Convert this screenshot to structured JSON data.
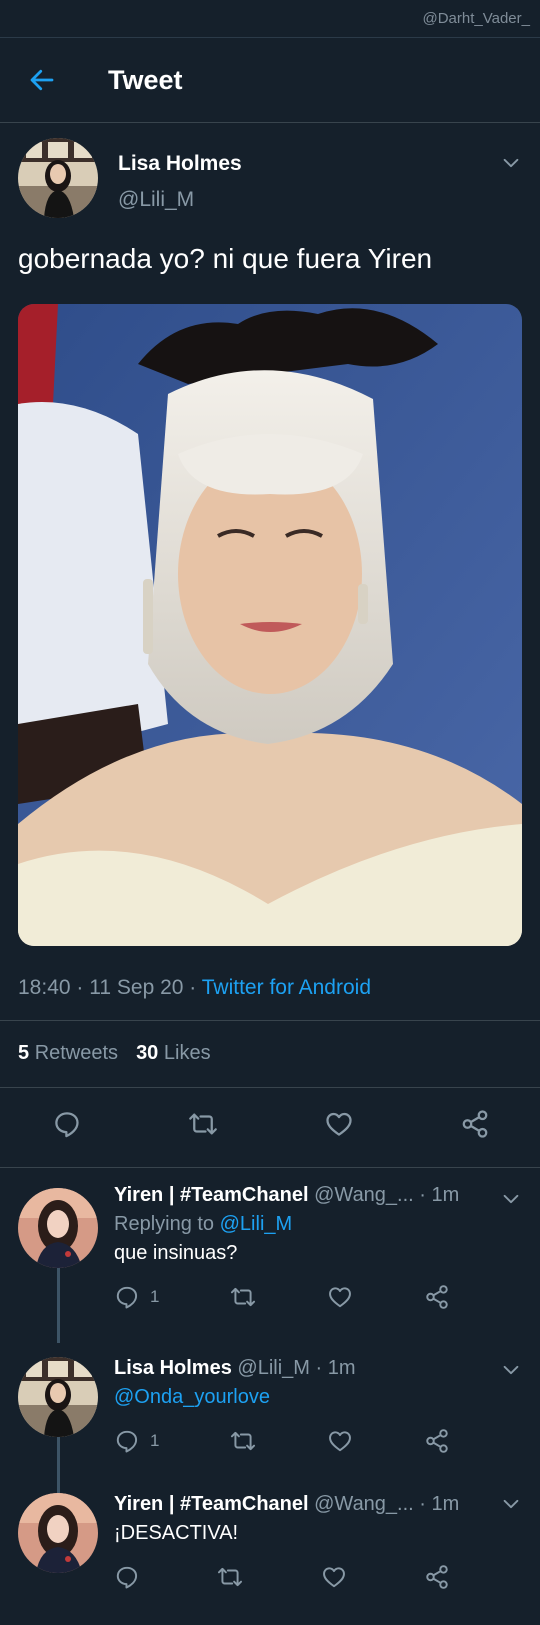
{
  "watermark": "@Darht_Vader_",
  "header": {
    "title": "Tweet"
  },
  "tweet": {
    "author_name": "Lisa Holmes",
    "author_handle": "@Lili_M",
    "text": "gobernada yo? ni que fuera Yiren",
    "time": "18:40",
    "date": "11 Sep 20",
    "source": "Twitter for Android",
    "retweets_count": "5",
    "retweets_label": "Retweets",
    "likes_count": "30",
    "likes_label": "Likes"
  },
  "replies": [
    {
      "name": "Yiren | #TeamChanel",
      "handle": "@Wang_...",
      "time": "1m",
      "replying_prefix": "Replying to",
      "replying_to": "@Lili_M",
      "text": "que insinuas?",
      "reply_count": "1"
    },
    {
      "name": "Lisa Holmes",
      "handle": "@Lili_M",
      "time": "1m",
      "text": "@Onda_yourlove",
      "reply_count": "1"
    },
    {
      "name": "Yiren | #TeamChanel",
      "handle": "@Wang_...",
      "time": "1m",
      "text": "¡DESACTIVA!"
    }
  ],
  "colors": {
    "background": "#15202b",
    "accent": "#1da1f2",
    "muted": "#8899a6",
    "divider": "#38444d"
  },
  "icons": [
    "back-arrow-icon",
    "chevron-down-icon",
    "reply-icon",
    "retweet-icon",
    "like-icon",
    "share-icon"
  ]
}
